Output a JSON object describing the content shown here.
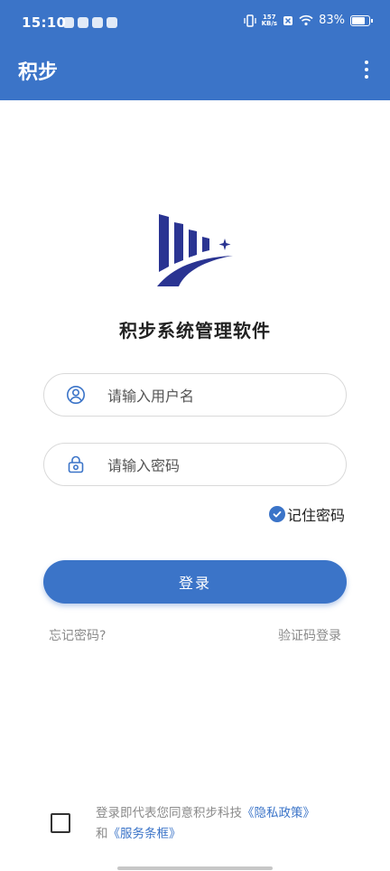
{
  "status_bar": {
    "time": "15:10",
    "net_speed_value": "157",
    "net_speed_unit": "KB/s",
    "battery": "83%"
  },
  "header": {
    "title": "积步",
    "menu_icon": "more-vertical-icon"
  },
  "branding": {
    "logo_icon": "jibu-logo-icon",
    "app_name": "积步系统管理软件"
  },
  "form": {
    "username": {
      "placeholder": "请输入用户名",
      "icon": "user-icon"
    },
    "password": {
      "placeholder": "请输入密码",
      "icon": "lock-icon"
    },
    "remember_label": "记住密码",
    "remember_checked": true,
    "login_label": "登录",
    "forgot_label": "忘记密码?",
    "sms_login_label": "验证码登录"
  },
  "agreement": {
    "checked": false,
    "prefix": "登录即代表您同意积步科技",
    "privacy_link": "《隐私政策》",
    "conjunction": "和",
    "terms_link": "《服务条框》"
  },
  "colors": {
    "primary": "#3b74c8",
    "logo_navy": "#2a3492"
  }
}
